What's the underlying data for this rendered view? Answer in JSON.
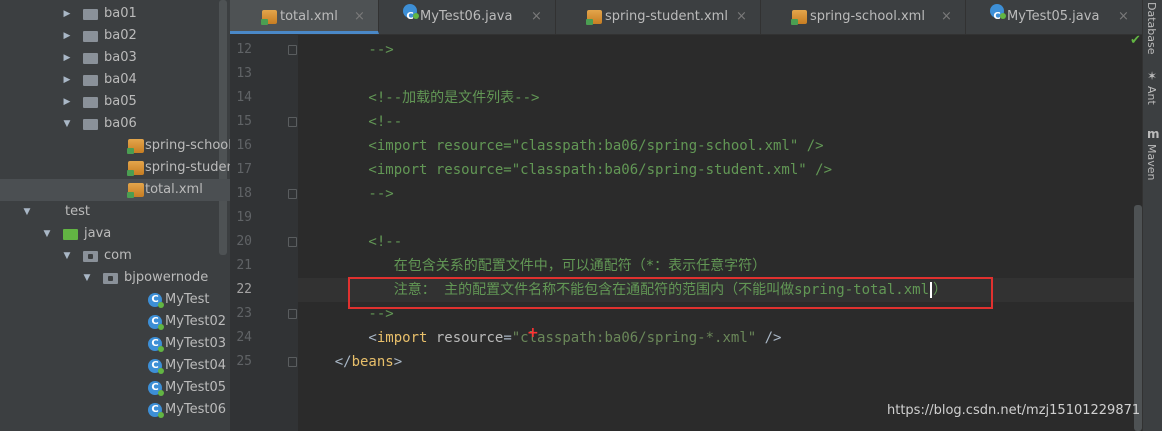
{
  "project_tree": [
    {
      "label": "ba01",
      "type": "folder",
      "expanded": false,
      "indent": 0
    },
    {
      "label": "ba02",
      "type": "folder",
      "expanded": false,
      "indent": 0
    },
    {
      "label": "ba03",
      "type": "folder",
      "expanded": false,
      "indent": 0
    },
    {
      "label": "ba04",
      "type": "folder",
      "expanded": false,
      "indent": 0
    },
    {
      "label": "ba05",
      "type": "folder",
      "expanded": false,
      "indent": 0
    },
    {
      "label": "ba06",
      "type": "folder",
      "expanded": true,
      "indent": 0
    },
    {
      "label": "spring-school.xml",
      "type": "xml",
      "indent": 1
    },
    {
      "label": "spring-student.xml",
      "type": "xml",
      "indent": 1
    },
    {
      "label": "total.xml",
      "type": "xml",
      "indent": 1,
      "selected": true
    },
    {
      "label": "test",
      "type": "none",
      "expanded": true,
      "indent": -2
    },
    {
      "label": "java",
      "type": "green-folder",
      "expanded": true,
      "indent": -1
    },
    {
      "label": "com",
      "type": "pkg",
      "expanded": true,
      "indent": 0
    },
    {
      "label": "bjpowernode",
      "type": "pkg",
      "expanded": true,
      "indent": 1
    },
    {
      "label": "MyTest",
      "type": "class",
      "indent": 2
    },
    {
      "label": "MyTest02",
      "type": "class",
      "indent": 2
    },
    {
      "label": "MyTest03",
      "type": "class",
      "indent": 2
    },
    {
      "label": "MyTest04",
      "type": "class",
      "indent": 2
    },
    {
      "label": "MyTest05",
      "type": "class",
      "indent": 2
    },
    {
      "label": "MyTest06",
      "type": "class",
      "indent": 2
    }
  ],
  "tabs": [
    {
      "label": "total.xml",
      "icon": "xml-file-icon",
      "active": true
    },
    {
      "label": "MyTest06.java",
      "icon": "java-class-icon",
      "active": false
    },
    {
      "label": "spring-student.xml",
      "icon": "xml-file-icon",
      "active": false
    },
    {
      "label": "spring-school.xml",
      "icon": "xml-file-icon",
      "active": false
    },
    {
      "label": "MyTest05.java",
      "icon": "java-class-icon",
      "active": false
    }
  ],
  "tab_close_glyph": "×",
  "right_strip": {
    "database": "Database",
    "ant": "Ant",
    "maven": "Maven"
  },
  "editor": {
    "lines": [
      {
        "num": "12",
        "segments": [
          {
            "cls": "c-comment",
            "text": "        -->"
          }
        ]
      },
      {
        "num": "13",
        "segments": []
      },
      {
        "num": "14",
        "segments": [
          {
            "cls": "c-comment",
            "text": "        <!--加载的是文件列表-->"
          }
        ]
      },
      {
        "num": "15",
        "segments": [
          {
            "cls": "c-comment",
            "text": "        <!--"
          }
        ]
      },
      {
        "num": "16",
        "segments": [
          {
            "cls": "c-comment",
            "text": "        <import resource=\"classpath:ba06/spring-school.xml\" />"
          }
        ]
      },
      {
        "num": "17",
        "segments": [
          {
            "cls": "c-comment",
            "text": "        <import resource=\"classpath:ba06/spring-student.xml\" />"
          }
        ]
      },
      {
        "num": "18",
        "segments": [
          {
            "cls": "c-comment",
            "text": "        -->"
          }
        ]
      },
      {
        "num": "19",
        "segments": []
      },
      {
        "num": "20",
        "segments": [
          {
            "cls": "c-comment",
            "text": "        <!--"
          }
        ]
      },
      {
        "num": "21",
        "segments": [
          {
            "cls": "c-comment",
            "text": "           在包含关系的配置文件中，可以通配符（*：表示任意字符）"
          }
        ]
      },
      {
        "num": "22",
        "segments": [
          {
            "cls": "c-comment",
            "text": "           注意： 主的配置文件名称不能包含在通配符的范围内（不能叫做spring-total.xml"
          },
          {
            "cls": "cursor",
            "text": ""
          },
          {
            "cls": "c-comment",
            "text": "）"
          }
        ],
        "current": true
      },
      {
        "num": "23",
        "segments": [
          {
            "cls": "c-comment",
            "text": "        -->"
          }
        ]
      },
      {
        "num": "24",
        "segments": [
          {
            "cls": "c-plain",
            "text": "        <"
          },
          {
            "cls": "c-tag",
            "text": "import "
          },
          {
            "cls": "c-attr",
            "text": "resource"
          },
          {
            "cls": "c-plain",
            "text": "="
          },
          {
            "cls": "c-val",
            "text": "\"classpath:ba06/spring-*.xml\""
          },
          {
            "cls": "c-plain",
            "text": " />"
          }
        ]
      },
      {
        "num": "25",
        "segments": [
          {
            "cls": "c-plain",
            "text": "    </"
          },
          {
            "cls": "c-tag",
            "text": "beans"
          },
          {
            "cls": "c-plain",
            "text": ">"
          }
        ]
      }
    ]
  },
  "watermark": "https://blog.csdn.net/mzj15101229871"
}
